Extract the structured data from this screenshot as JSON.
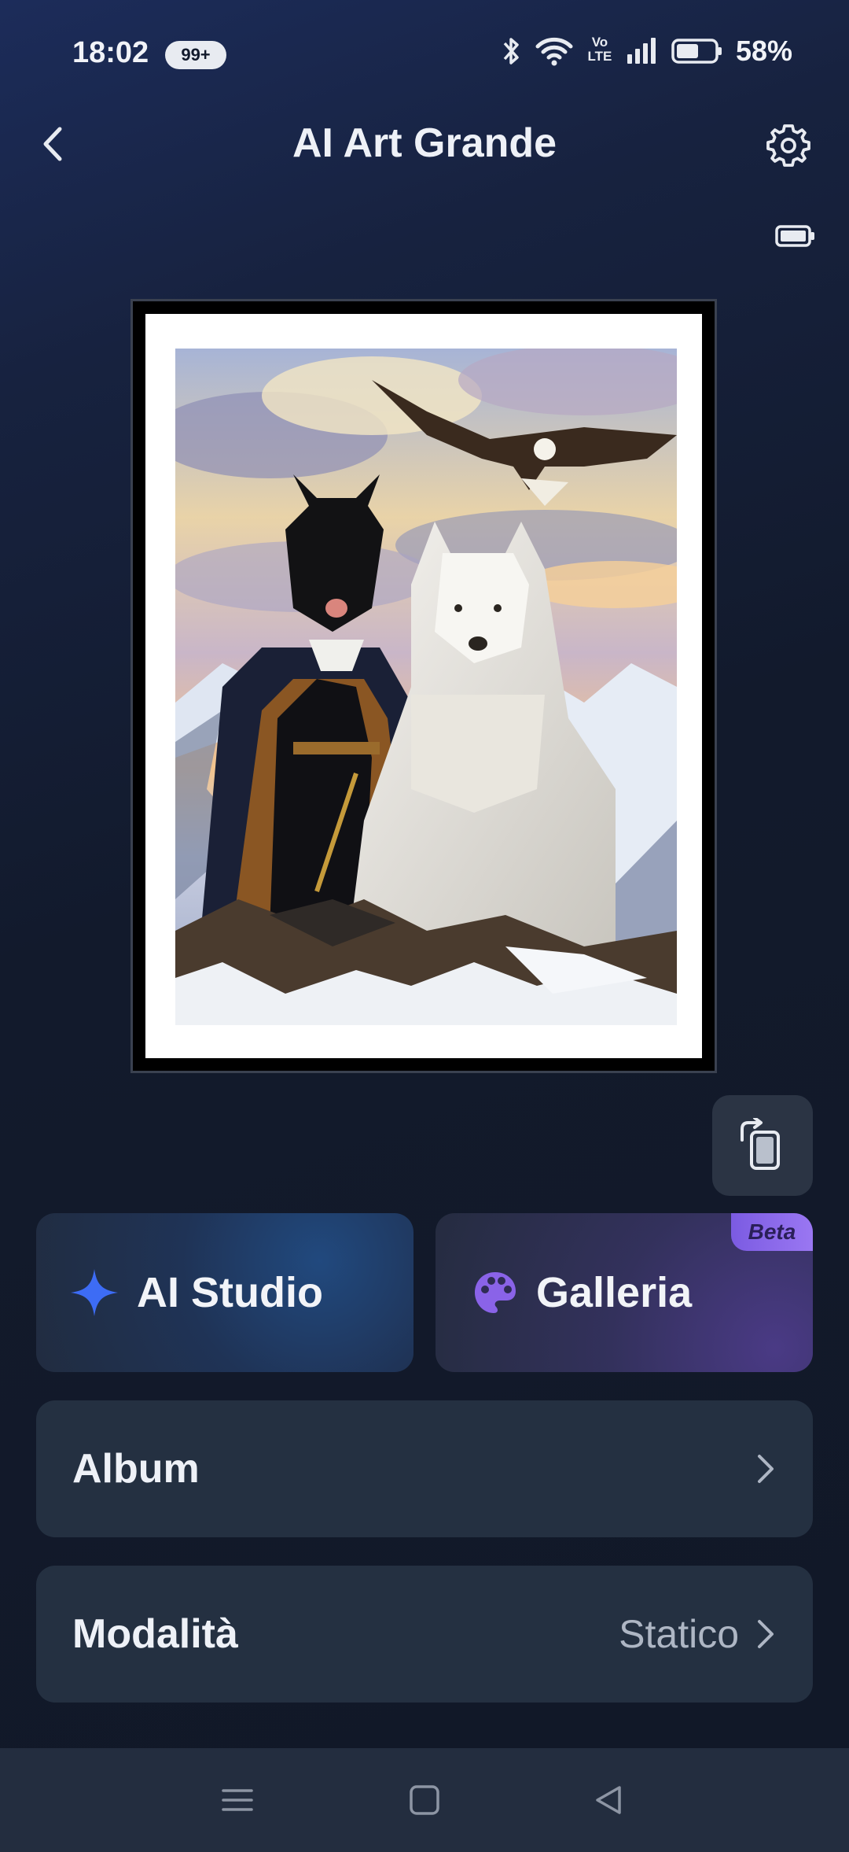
{
  "status_bar": {
    "time": "18:02",
    "notification_badge": "99+",
    "network_label": "Vo LTE",
    "battery_percent": "58%",
    "battery_level": 0.58
  },
  "header": {
    "title": "AI Art Grande",
    "back_icon": "chevron-left-icon",
    "settings_icon": "gear-icon"
  },
  "device": {
    "battery_icon": "battery-full-icon"
  },
  "artwork": {
    "frame_color": "#000000",
    "mat_color": "#ffffff"
  },
  "actions": {
    "ai_studio_label": "AI Studio",
    "gallery_label": "Galleria",
    "gallery_badge": "Beta",
    "accent_blue": "#3d6cf5",
    "accent_purple": "#8a63e8"
  },
  "rows": {
    "album_label": "Album",
    "mode_label": "Modalità",
    "mode_value": "Statico"
  },
  "nav": {
    "menu_icon": "menu-icon",
    "home_icon": "square-home-icon",
    "back_icon": "triangle-back-icon"
  }
}
